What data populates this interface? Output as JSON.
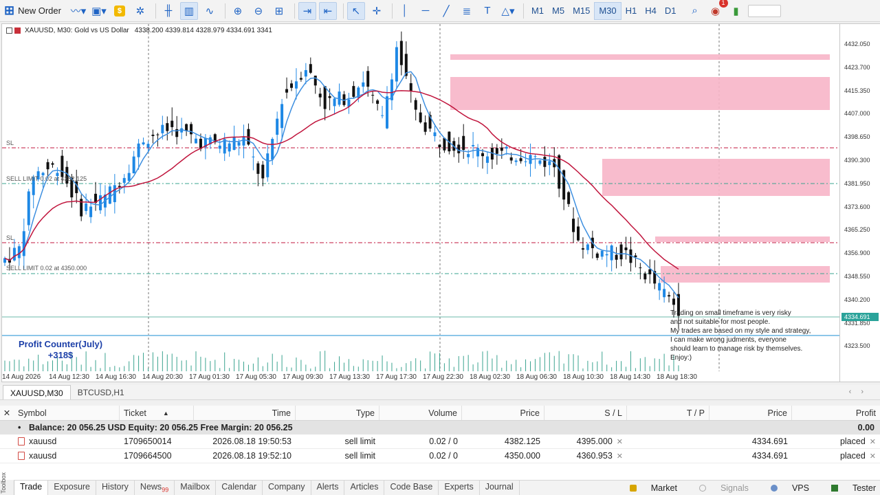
{
  "toolbar": {
    "new_order": "New Order",
    "timeframes": [
      "M1",
      "M5",
      "M15",
      "M30",
      "H1",
      "H4",
      "D1"
    ],
    "active_timeframe": "M30",
    "notification_count": "1"
  },
  "chart": {
    "symbol_header": "XAUUSD, M30:  Gold vs US Dollar",
    "ohlc_header": "4338.200  4339.814  4328.979  4334.691  3341",
    "current_price": "4334.691",
    "price_axis": [
      "4432.050",
      "4423.700",
      "4415.350",
      "4407.000",
      "4398.650",
      "4390.300",
      "4381.950",
      "4373.600",
      "4365.250",
      "4356.900",
      "4348.550",
      "4340.200",
      "4331.850",
      "4323.500"
    ],
    "time_axis": [
      "14 Aug 2026",
      "14 Aug 12:30",
      "14 Aug 16:30",
      "14 Aug 20:30",
      "17 Aug 01:30",
      "17 Aug 05:30",
      "17 Aug 09:30",
      "17 Aug 13:30",
      "17 Aug 17:30",
      "17 Aug 22:30",
      "18 Aug 02:30",
      "18 Aug 06:30",
      "18 Aug 10:30",
      "18 Aug 14:30",
      "18 Aug 18:30"
    ],
    "order_lines": {
      "sl1": "SL",
      "sell_limit_1": "SELL LIMIT 0.02 at 4382.125",
      "sl2": "SL",
      "sell_limit_2": "SELL LIMIT 0.02 at 4350.000"
    },
    "profit_counter": {
      "title": "Profit Counter(July)",
      "value": "+318$"
    },
    "note": "Trading on small timeframe is very risky\nand not suitable for most people.\nMy trades are based on my style and strategy,\nI can make wrong judments, everyone\nshould learn to manage risk by themselves.\nEnjoy:)",
    "colors": {
      "bull": "#1e88e5",
      "bear": "#111111",
      "fast_ma": "#3d8fe0",
      "slow_ma": "#c0143c",
      "zone": "#f7b5c8"
    }
  },
  "chart_tabs": [
    "XAUUSD,M30",
    "BTCUSD,H1"
  ],
  "terminal": {
    "columns": [
      "Symbol",
      "Ticket",
      "Time",
      "Type",
      "Volume",
      "Price",
      "S / L",
      "T / P",
      "Price",
      "Profit"
    ],
    "summary": "Balance: 20 056.25 USD  Equity: 20 056.25  Free Margin: 20 056.25",
    "summary_profit": "0.00",
    "rows": [
      {
        "symbol": "xauusd",
        "ticket": "1709650014",
        "time": "2026.08.18 19:50:53",
        "type": "sell limit",
        "volume": "0.02 / 0",
        "price": "4382.125",
        "sl": "4395.000",
        "tp": "",
        "cur_price": "4334.691",
        "profit": "placed"
      },
      {
        "symbol": "xauusd",
        "ticket": "1709664500",
        "time": "2026.08.18 19:52:10",
        "type": "sell limit",
        "volume": "0.02 / 0",
        "price": "4350.000",
        "sl": "4360.953",
        "tp": "",
        "cur_price": "4334.691",
        "profit": "placed"
      }
    ]
  },
  "toolbox_label": "Toolbox",
  "bottom_tabs": [
    "Trade",
    "Exposure",
    "History",
    "News",
    "Mailbox",
    "Calendar",
    "Company",
    "Alerts",
    "Articles",
    "Code Base",
    "Experts",
    "Journal"
  ],
  "news_count": "99",
  "bottom_right": {
    "market": "Market",
    "signals": "Signals",
    "vps": "VPS",
    "tester": "Tester"
  }
}
